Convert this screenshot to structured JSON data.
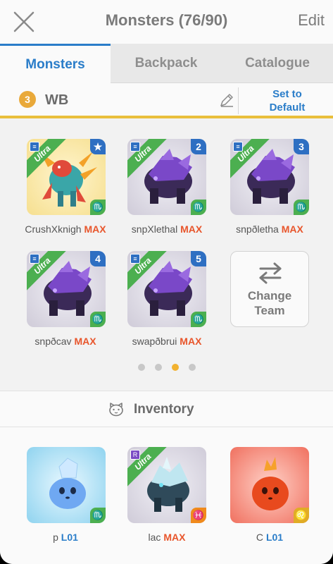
{
  "header": {
    "title": "Monsters (76/90)",
    "edit_label": "Edit",
    "close_icon": "close-icon"
  },
  "tabs": [
    {
      "label": "Monsters",
      "active": true
    },
    {
      "label": "Backpack",
      "active": false
    },
    {
      "label": "Catalogue",
      "active": false
    }
  ],
  "team": {
    "number": "3",
    "name": "WB",
    "set_default_line1": "Set to",
    "set_default_line2": "Default"
  },
  "team_monsters": [
    {
      "name": "CrushXknigh",
      "level": "MAX",
      "rarity": "Ultra",
      "slot": "★",
      "element": "♏",
      "bg": "yellow"
    },
    {
      "name": "snpXlethal",
      "level": "MAX",
      "rarity": "Ultra",
      "slot": "2",
      "element": "♏",
      "bg": "grey"
    },
    {
      "name": "snpðletha",
      "level": "MAX",
      "rarity": "Ultra",
      "slot": "3",
      "element": "♏",
      "bg": "grey"
    },
    {
      "name": "snpðcav",
      "level": "MAX",
      "rarity": "Ultra",
      "slot": "4",
      "element": "♏",
      "bg": "grey"
    },
    {
      "name": "swapðbrui",
      "level": "MAX",
      "rarity": "Ultra",
      "slot": "5",
      "element": "♏",
      "bg": "grey"
    }
  ],
  "change_team": {
    "line1": "Change",
    "line2": "Team"
  },
  "pager": {
    "count": 4,
    "active_index": 2
  },
  "inventory": {
    "title": "Inventory",
    "items": [
      {
        "name": "p",
        "level": "L01",
        "element": "♏",
        "bg": "blue"
      },
      {
        "name": "lac",
        "level": "MAX",
        "rarity": "Ultra",
        "element": "♓",
        "bg": "grey"
      },
      {
        "name": "C",
        "level": "L01",
        "element": "♌",
        "bg": "red"
      }
    ]
  },
  "colors": {
    "accent": "#2a7dc9",
    "max": "#e8552b",
    "ultra": "#4caf50",
    "team_bar": "#e9bf3b"
  }
}
